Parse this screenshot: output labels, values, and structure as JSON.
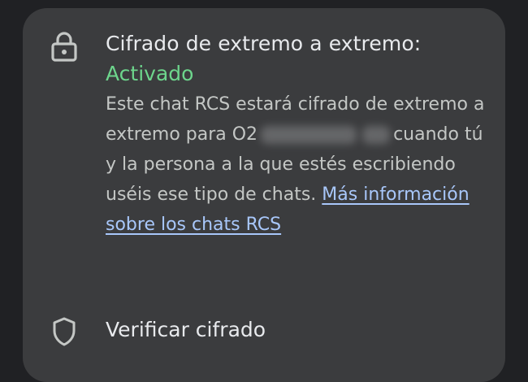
{
  "encryption": {
    "icon": "lock-icon",
    "title": "Cifrado de extremo a extremo:",
    "status": "Activado",
    "status_color": "#6dd58c",
    "desc_part1": "Este chat RCS estará cifrado de extremo a extremo para O2",
    "desc_part2": "cuando tú y la persona a la que estés escribiendo uséis ese tipo de chats.",
    "learn_more_link": "Más información sobre los chats RCS",
    "link_color": "#a8c7fa"
  },
  "verify": {
    "icon": "shield-icon",
    "label": "Verificar cifrado"
  }
}
